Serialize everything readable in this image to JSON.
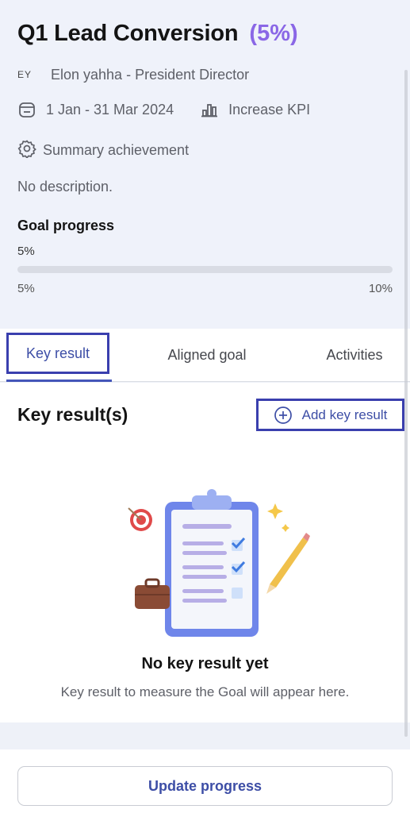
{
  "goal": {
    "title": "Q1 Lead Conversion",
    "percent_text": "(5%)",
    "owner_initials": "EY",
    "owner_text": "Elon yahha - President Director",
    "date_range": "1 Jan - 31 Mar 2024",
    "kpi_type": "Increase KPI",
    "summary_label": "Summary achievement",
    "description": "No description."
  },
  "progress": {
    "label": "Goal progress",
    "value_text": "5%",
    "fill_fraction": 0.0,
    "min_text": "5%",
    "max_text": "10%"
  },
  "tabs": [
    {
      "label": "Key result",
      "active": true
    },
    {
      "label": "Aligned goal",
      "active": false
    },
    {
      "label": "Activities",
      "active": false
    }
  ],
  "key_results": {
    "heading": "Key result(s)",
    "add_label": "Add key result",
    "empty_title": "No key result yet",
    "empty_subtitle": "Key result to measure the Goal will appear here."
  },
  "footer": {
    "update_label": "Update progress"
  },
  "colors": {
    "accent_purple": "#8a67e6",
    "primary_blue": "#3d4ea6",
    "highlight_border": "#3a3fae"
  },
  "icons": [
    "calendar-icon",
    "bar-chart-icon",
    "gear-icon",
    "plus-circle-icon"
  ]
}
